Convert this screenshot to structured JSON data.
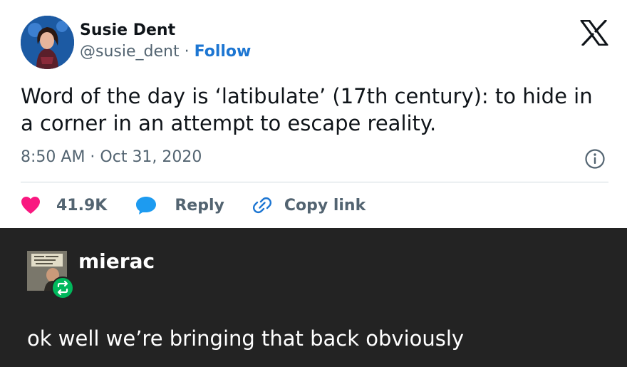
{
  "tweet": {
    "author_name": "Susie Dent",
    "handle": "@susie_dent",
    "separator": "·",
    "follow_label": "Follow",
    "text": "Word of the day is ‘latibulate’ (17th century): to hide in a corner in an attempt to escape reality.",
    "timestamp": "8:50 AM · Oct 31, 2020",
    "likes": "41.9K",
    "reply_label": "Reply",
    "copy_link_label": "Copy link",
    "icons": [
      "x-logo-icon",
      "info-icon",
      "heart-icon",
      "reply-bubble-icon",
      "link-icon"
    ],
    "colors": {
      "heart": "#f91880",
      "reply": "#1d9bf0",
      "follow": "#1d76d2",
      "link_icon": "#1d76d2"
    }
  },
  "reblog": {
    "username": "mierac",
    "text": "ok well we’re bringing that back obviously",
    "icons": [
      "reblog-icon"
    ],
    "colors": {
      "background": "#232323",
      "badge": "#00b85c"
    }
  }
}
